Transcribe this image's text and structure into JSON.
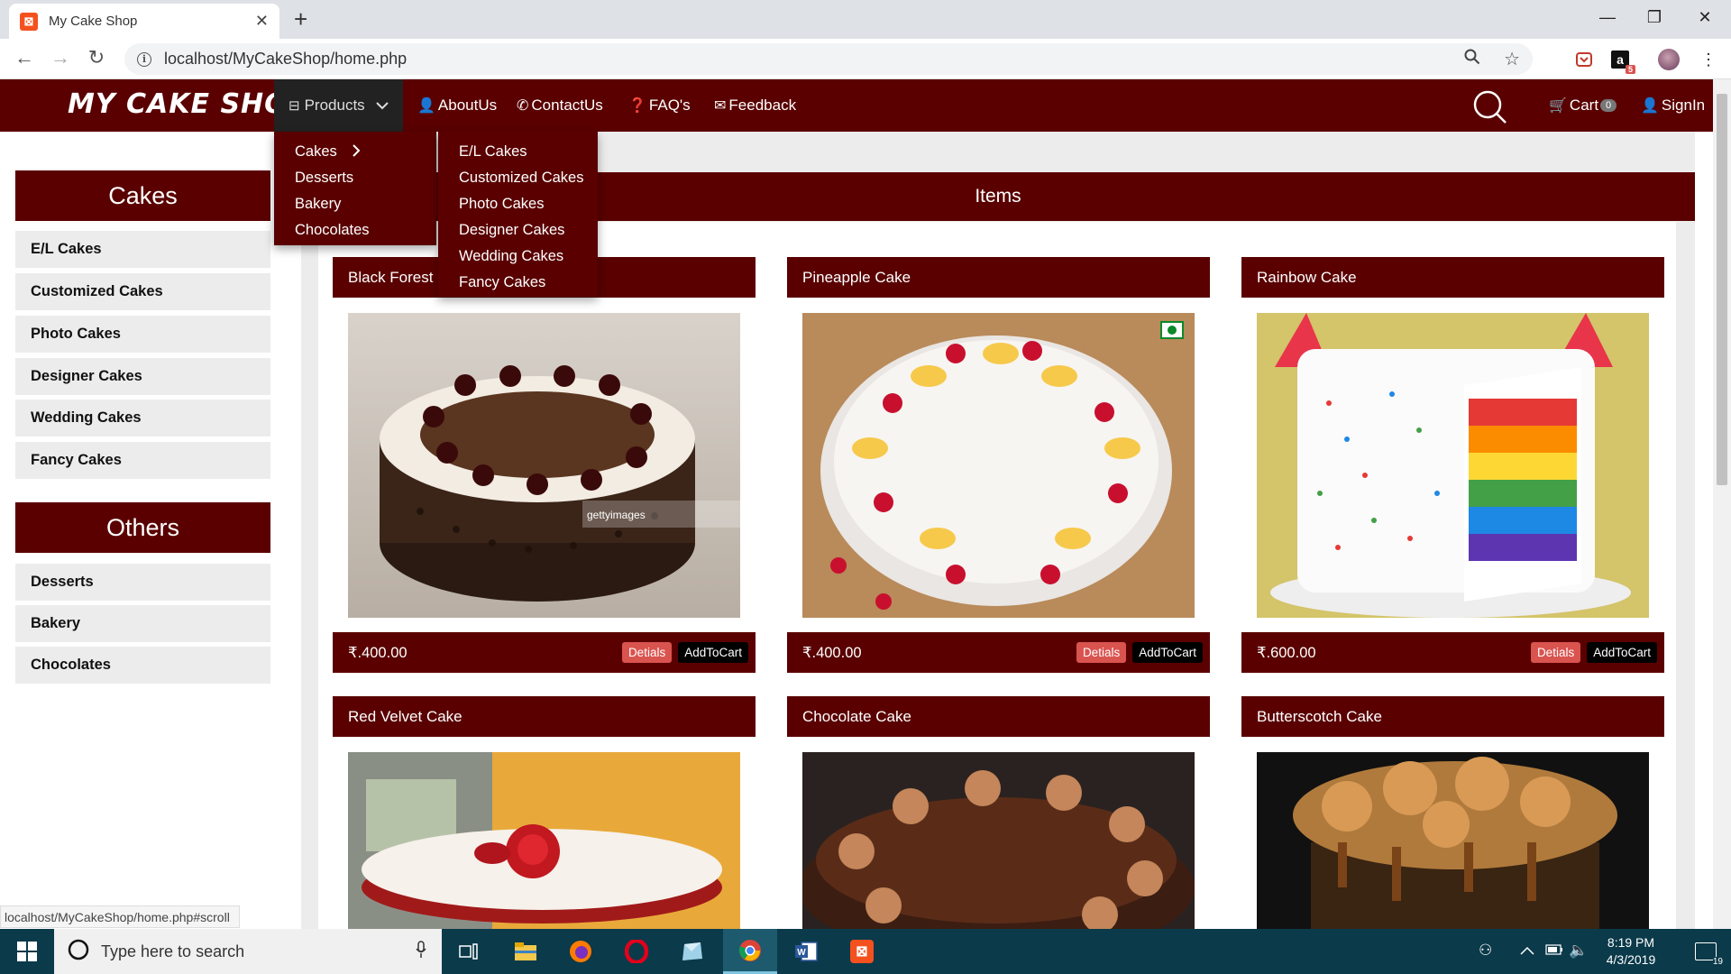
{
  "browser": {
    "tab_title": "My Cake Shop",
    "tab_icon": "xampp-icon",
    "url": "localhost/MyCakeShop/home.php",
    "status_url": "localhost/MyCakeShop/home.php#scroll",
    "extension_badge": "5"
  },
  "site": {
    "logo": "MY CAKE SHOP",
    "nav": {
      "products": "Products",
      "about": "AboutUs",
      "contact": "ContactUs",
      "faq": "FAQ's",
      "feedback": "Feedback",
      "cart": "Cart",
      "cart_count": "0",
      "signin": "SignIn"
    },
    "products_menu": [
      "Cakes",
      "Desserts",
      "Bakery",
      "Chocolates"
    ],
    "cakes_menu": [
      "E/L Cakes",
      "Customized Cakes",
      "Photo Cakes",
      "Designer Cakes",
      "Wedding Cakes",
      "Fancy Cakes"
    ]
  },
  "sidebar": {
    "cakes_title": "Cakes",
    "cakes_items": [
      "E/L Cakes",
      "Customized Cakes",
      "Photo Cakes",
      "Designer Cakes",
      "Wedding Cakes",
      "Fancy Cakes"
    ],
    "others_title": "Others",
    "others_items": [
      "Desserts",
      "Bakery",
      "Chocolates"
    ]
  },
  "main": {
    "heading": "Items",
    "details_label": "Detials",
    "addtocart_label": "AddToCart",
    "products": [
      {
        "name": "Black Forest",
        "price": "₹.400.00"
      },
      {
        "name": "Pineapple Cake",
        "price": "₹.400.00"
      },
      {
        "name": "Rainbow Cake",
        "price": "₹.600.00"
      },
      {
        "name": "Red Velvet Cake",
        "price": ""
      },
      {
        "name": "Chocolate Cake",
        "price": ""
      },
      {
        "name": "Butterscotch Cake",
        "price": ""
      }
    ],
    "image_watermark": "gettyimages"
  },
  "taskbar": {
    "search_placeholder": "Type here to search",
    "time": "8:19 PM",
    "date": "4/3/2019",
    "notifications": "19"
  },
  "colors": {
    "brand": "#5a0000",
    "details_button": "#d9534f",
    "taskbar": "#0b3a4a"
  }
}
